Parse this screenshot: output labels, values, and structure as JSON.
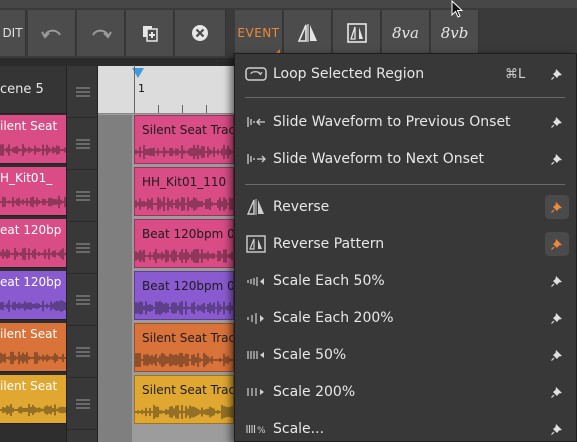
{
  "toolbar": {
    "edit_label": "DIT",
    "event_label": "EVENT",
    "octave_up_label": "8va",
    "octave_down_label": "8vb"
  },
  "scenes": {
    "header": "cene 5",
    "clips": [
      {
        "label": "ilent Seat",
        "color": "#d94c86"
      },
      {
        "label": "H_Kit01_",
        "color": "#d94c86"
      },
      {
        "label": "eat 120bp",
        "color": "#d94c86"
      },
      {
        "label": "eat 120bp",
        "color": "#8a5bd0"
      },
      {
        "label": "ilent Seat",
        "color": "#d9733a"
      },
      {
        "label": "ilent Seat",
        "color": "#e0a830"
      }
    ]
  },
  "timeline": {
    "bar_number": "1",
    "clips": [
      {
        "label": "Silent Seat Trac",
        "color": "#d94c86"
      },
      {
        "label": "HH_Kit01_110",
        "color": "#d94c86"
      },
      {
        "label": "Beat 120bpm 0",
        "color": "#d94c86"
      },
      {
        "label": "Beat 120bpm 0",
        "color": "#8a5bd0"
      },
      {
        "label": "Silent Seat Trac",
        "color": "#d9733a"
      },
      {
        "label": "Silent Seat Trac",
        "color": "#e0a830"
      }
    ]
  },
  "menu": {
    "items": [
      {
        "label": "Loop Selected Region",
        "shortcut": "⌘L",
        "icon": "loop-region-icon",
        "pinned": false
      },
      {
        "label": "Slide Waveform to Previous Onset",
        "icon": "slide-previous-onset-icon",
        "pinned": false
      },
      {
        "label": "Slide Waveform to Next Onset",
        "icon": "slide-next-onset-icon",
        "pinned": false
      },
      {
        "label": "Reverse",
        "icon": "reverse-icon",
        "pinned": true
      },
      {
        "label": "Reverse Pattern",
        "icon": "reverse-pattern-icon",
        "pinned": true
      },
      {
        "label": "Scale Each 50%",
        "icon": "scale-each-50-icon",
        "pinned": false
      },
      {
        "label": "Scale Each 200%",
        "icon": "scale-each-200-icon",
        "pinned": false
      },
      {
        "label": "Scale 50%",
        "icon": "scale-50-icon",
        "pinned": false
      },
      {
        "label": "Scale 200%",
        "icon": "scale-200-icon",
        "pinned": false
      },
      {
        "label": "Scale...",
        "icon": "scale-custom-icon",
        "pinned": false
      }
    ]
  },
  "colors": {
    "accent_orange": "#f0883a",
    "pin_active": "#f0883a",
    "pin_inactive": "#e0e0e0"
  }
}
